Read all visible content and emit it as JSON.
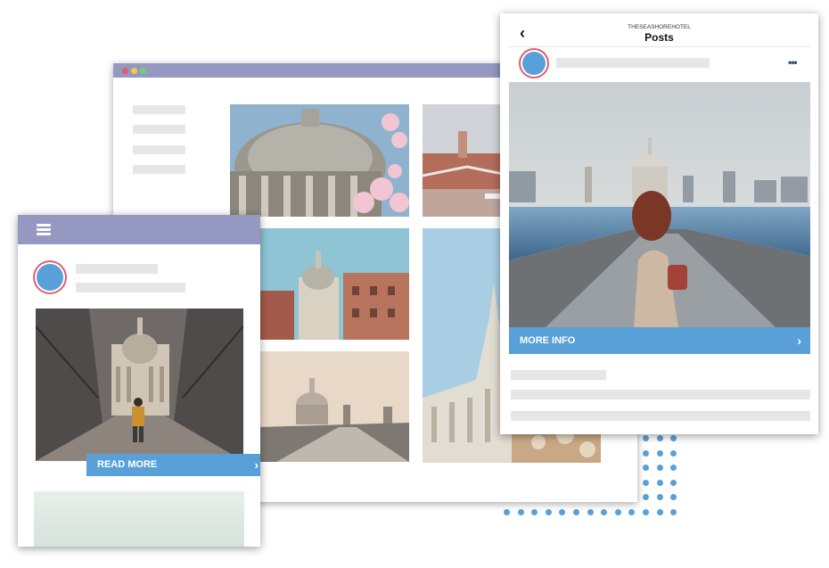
{
  "desktop_window": {
    "controls": [
      {
        "name": "close",
        "color": "#e05c6e"
      },
      {
        "name": "minimize",
        "color": "#f2c94c"
      },
      {
        "name": "maximize",
        "color": "#6fcf73"
      }
    ]
  },
  "mobile_card": {
    "cta_label": "READ MORE",
    "cta_icon": "chevron-right-icon",
    "menu_icon": "hamburger-menu-icon"
  },
  "phone_post": {
    "account_name": "THESEASHOREHOTEL",
    "screen_title": "Posts",
    "back_icon": "chevron-left-icon",
    "more_icon": "more-horizontal-icon",
    "cta_label": "MORE INFO",
    "cta_icon": "chevron-right-icon"
  },
  "colors": {
    "accent_blue": "#5aa0d8",
    "header_lavender": "#9598c0",
    "avatar_ring": "#e05c6e",
    "skeleton": "#e6e6e6"
  }
}
